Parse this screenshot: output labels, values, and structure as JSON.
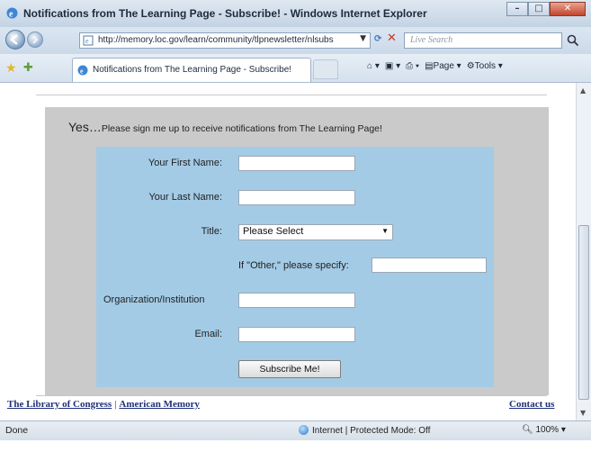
{
  "window": {
    "title": "Notifications from The Learning Page - Subscribe! - Windows Internet Explorer"
  },
  "address_bar": {
    "url": "http://memory.loc.gov/learn/community/tlpnewsletter/nlsubs",
    "search_placeholder": "Live Search"
  },
  "tab": {
    "label": "Notifications from The Learning Page - Subscribe!"
  },
  "toolbar": {
    "page_label": "Page",
    "tools_label": "Tools"
  },
  "form": {
    "heading_big": "Yes…",
    "heading_small": "Please sign me up to receive notifications from The Learning Page!",
    "first_name_label": "Your First Name:",
    "last_name_label": "Your Last Name:",
    "title_label": "Title:",
    "title_select_value": "Please Select",
    "other_label": "If \"Other,\" please specify:",
    "org_label": "Organization/Institution",
    "email_label": "Email:",
    "submit_label": "Subscribe Me!"
  },
  "footer": {
    "link_loc": "The Library of Congress",
    "link_am": "American Memory",
    "contact": "Contact us"
  },
  "status_bar": {
    "status": "Done",
    "zone": "Internet | Protected Mode: Off",
    "zoom": "100%"
  }
}
